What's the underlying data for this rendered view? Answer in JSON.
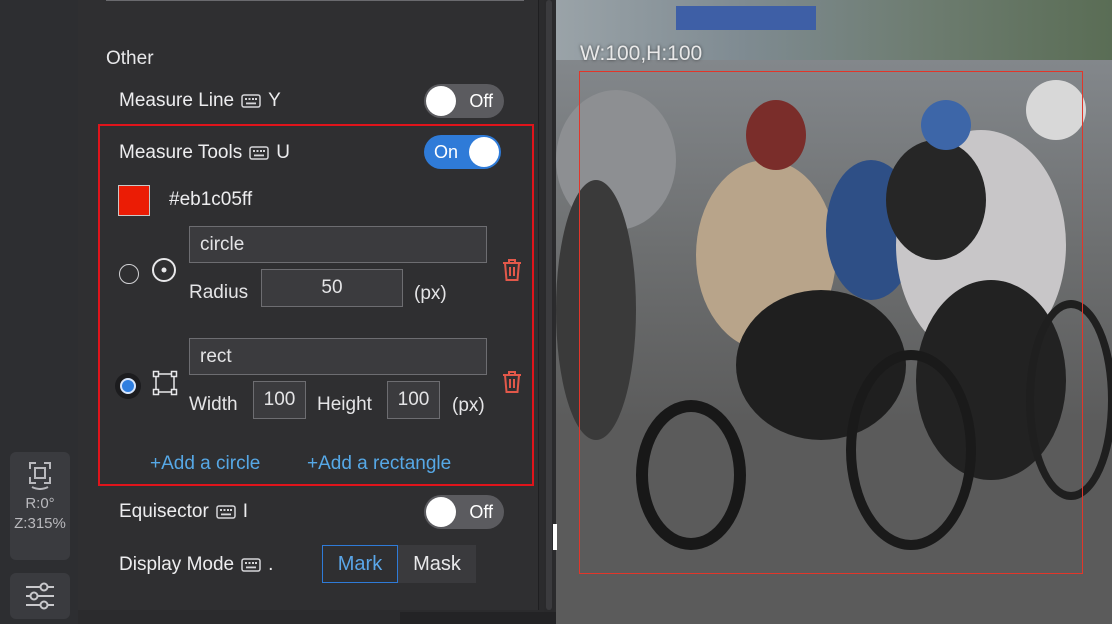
{
  "rotation_widget": {
    "rotation": "R:0°",
    "zoom": "Z:315%"
  },
  "panel": {
    "section_title": "Other",
    "measure_line": {
      "label": "Measure Line",
      "shortcut": "Y",
      "toggle": "Off"
    },
    "measure_tools": {
      "label": "Measure Tools",
      "shortcut": "U",
      "toggle": "On",
      "color": "#eb1c05ff",
      "circle": {
        "name": "circle",
        "radius_label": "Radius",
        "radius": "50",
        "unit": "(px)",
        "selected": false
      },
      "rect": {
        "name": "rect",
        "width_label": "Width",
        "width": "100",
        "height_label": "Height",
        "height": "100",
        "unit": "(px)",
        "selected": true
      },
      "add_circle": "+Add a circle",
      "add_rectangle": "+Add a rectangle"
    },
    "equisector": {
      "label": "Equisector",
      "shortcut": "I",
      "toggle": "Off"
    },
    "display_mode": {
      "label": "Display Mode",
      "shortcut": ".",
      "options": [
        "Mark",
        "Mask"
      ],
      "active": "Mark"
    }
  },
  "canvas": {
    "measure_label": "W:100,H:100",
    "measure_color": "#e2362a"
  },
  "colors": {
    "accent": "#2f7bd8",
    "link": "#56a8e6",
    "danger": "#e2584a",
    "highlight_border": "#e0141b"
  }
}
